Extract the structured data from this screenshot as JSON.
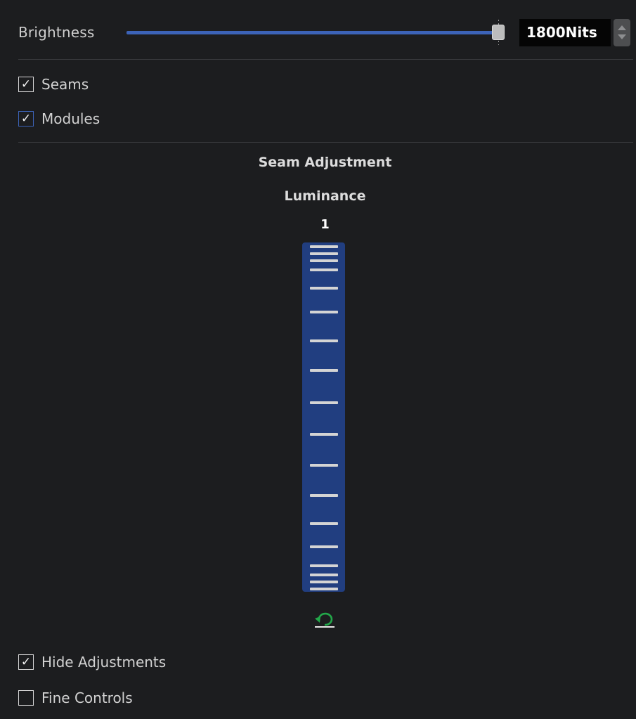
{
  "brightness": {
    "label": "Brightness",
    "value_text": "1800Nits",
    "slider_fraction": 1.0,
    "accent_color": "#3c63b8"
  },
  "checkboxes": {
    "seams": {
      "label": "Seams",
      "checked": true
    },
    "modules": {
      "label": "Modules",
      "checked": true
    }
  },
  "seam_adjustment": {
    "title": "Seam Adjustment",
    "parameter": "Luminance",
    "value": "1",
    "bar_color": "#213e80",
    "reset_icon": "undo-arrow-icon"
  },
  "bottom_options": {
    "hide_adjustments": {
      "label": "Hide Adjustments",
      "checked": true
    },
    "fine_controls": {
      "label": "Fine Controls",
      "checked": false
    }
  }
}
